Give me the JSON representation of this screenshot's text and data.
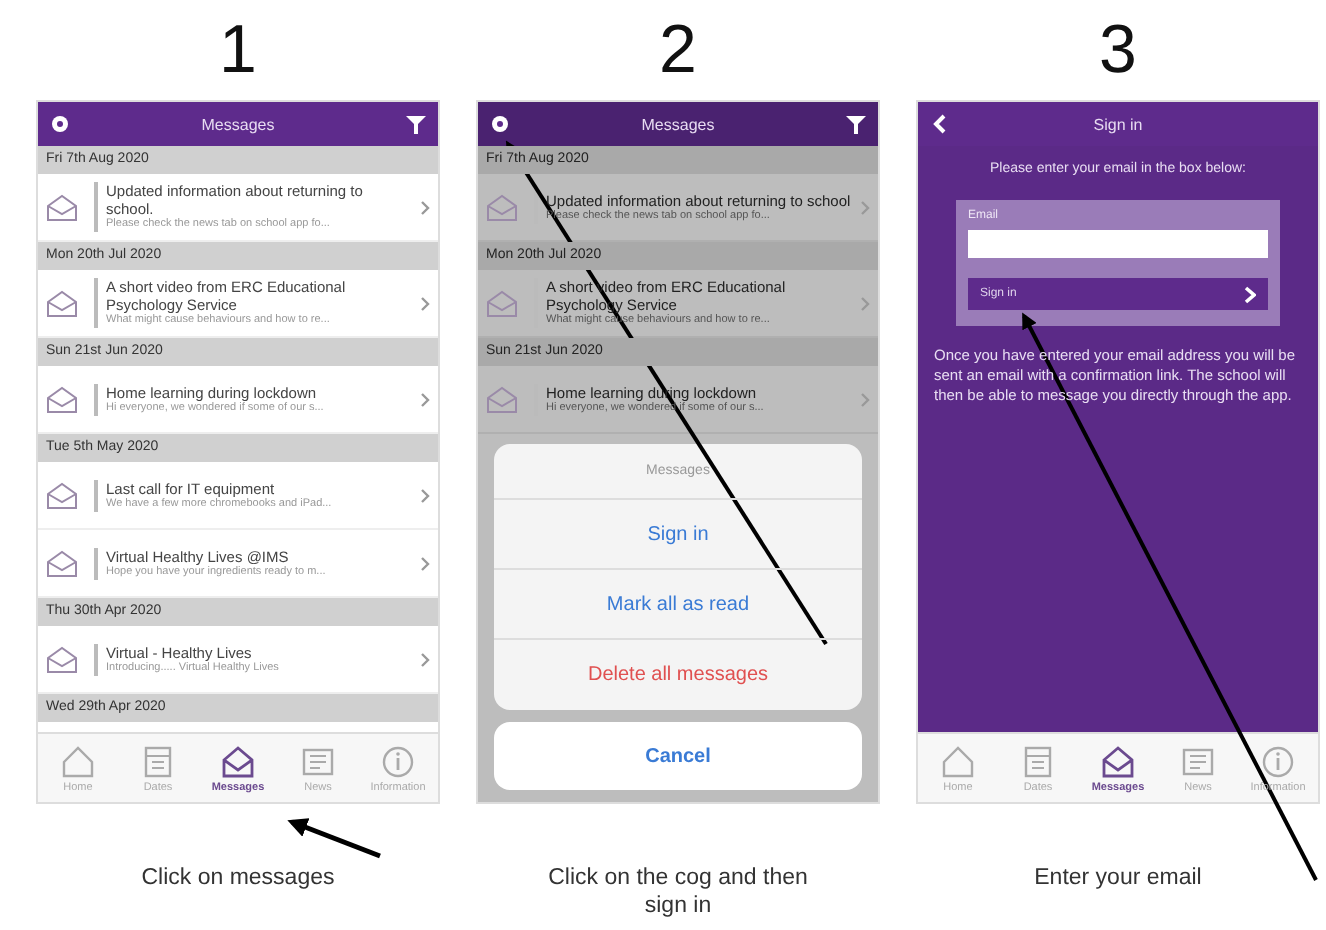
{
  "panels": [
    {
      "number": "1",
      "kind": "messages",
      "caption": "Click on messages",
      "screen": {
        "title": "Messages",
        "dimmed": false,
        "groups": [
          {
            "date": "Fri 7th Aug 2020",
            "messages": [
              {
                "title": "Updated information about returning to school.",
                "preview": "Please check the news tab on school app fo..."
              }
            ]
          },
          {
            "date": "Mon 20th Jul 2020",
            "messages": [
              {
                "title": "A short video from ERC Educational Psychology Service",
                "preview": "What might cause behaviours and how to re..."
              }
            ]
          },
          {
            "date": "Sun 21st Jun 2020",
            "messages": [
              {
                "title": "Home learning during lockdown",
                "preview": "Hi everyone, we wondered if some of our s..."
              }
            ]
          },
          {
            "date": "Tue 5th May 2020",
            "messages": [
              {
                "title": "Last call for IT equipment",
                "preview": "We have a few more chromebooks and iPad..."
              },
              {
                "title": "Virtual Healthy Lives @IMS",
                "preview": "Hope you have your ingredients ready to m..."
              }
            ]
          },
          {
            "date": "Thu 30th Apr 2020",
            "messages": [
              {
                "title": "Virtual - Healthy Lives",
                "preview": "Introducing..... Virtual Healthy Lives"
              }
            ]
          },
          {
            "date": "Wed 29th Apr 2020"
          }
        ],
        "tabs": [
          {
            "label": "Home",
            "selected": false
          },
          {
            "label": "Dates",
            "selected": false
          },
          {
            "label": "Messages",
            "selected": true
          },
          {
            "label": "News",
            "selected": false
          },
          {
            "label": "Information",
            "selected": false
          }
        ]
      }
    },
    {
      "number": "2",
      "kind": "messages",
      "caption": "Click on the cog and then sign in",
      "screen": {
        "title": "Messages",
        "dimmed": true,
        "groups": [
          {
            "date": "Fri 7th Aug 2020",
            "messages": [
              {
                "title": "Updated information about returning to school",
                "preview": "Please check the news tab on school app fo..."
              }
            ]
          },
          {
            "date": "Mon 20th Jul 2020",
            "messages": [
              {
                "title": "A short video from ERC Educational Psychology Service",
                "preview": "What might cause behaviours and how to re..."
              }
            ]
          },
          {
            "date": "Sun 21st Jun 2020",
            "messages": [
              {
                "title": "Home learning during lockdown",
                "preview": "Hi everyone, we wondered if some of our s..."
              }
            ]
          }
        ],
        "sheet": {
          "title": "Messages",
          "actions": [
            {
              "label": "Sign in",
              "kind": "normal"
            },
            {
              "label": "Mark all as read",
              "kind": "normal"
            },
            {
              "label": "Delete all messages",
              "kind": "destructive"
            }
          ],
          "cancel": "Cancel"
        }
      }
    },
    {
      "number": "3",
      "kind": "sign_in",
      "caption": "Enter your email",
      "screen": {
        "title": "Sign in",
        "intro": "Please enter your email in the box below:",
        "field_label": "Email",
        "button": "Sign in",
        "note": "Once you have entered your email address you will be sent an email with a confirmation link. The school will then be able to message you directly through the app.",
        "tabs": [
          {
            "label": "Home",
            "selected": false
          },
          {
            "label": "Dates",
            "selected": false
          },
          {
            "label": "Messages",
            "selected": true
          },
          {
            "label": "News",
            "selected": false
          },
          {
            "label": "Information",
            "selected": false
          }
        ]
      }
    }
  ]
}
